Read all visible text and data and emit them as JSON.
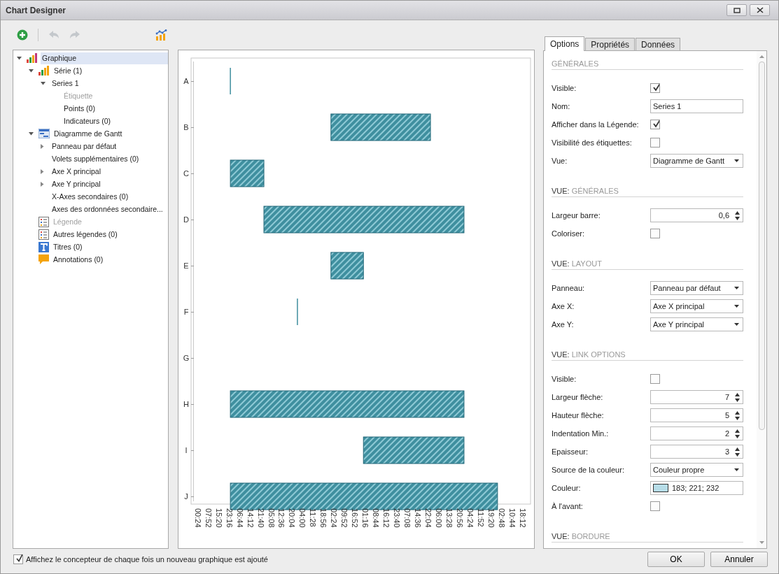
{
  "window": {
    "title": "Chart Designer"
  },
  "toolbar": {
    "undo_disabled": true,
    "redo_disabled": true
  },
  "tree": [
    {
      "label": "Graphique",
      "kind": "chart",
      "selected": true,
      "disabled": false,
      "expanded": true,
      "children": [
        {
          "label": "Série (1)",
          "kind": "series",
          "selected": false,
          "disabled": false,
          "expanded": true,
          "children": [
            {
              "label": "Series 1",
              "selected": false,
              "disabled": false,
              "expanded": true,
              "children": [
                {
                  "label": "Étiquette",
                  "selected": false,
                  "disabled": true
                },
                {
                  "label": "Points (0)",
                  "selected": false,
                  "disabled": false
                },
                {
                  "label": "Indicateurs (0)",
                  "selected": false,
                  "disabled": false
                }
              ]
            }
          ]
        },
        {
          "label": "Diagramme de Gantt",
          "kind": "diagram",
          "selected": false,
          "disabled": false,
          "expanded": true,
          "children": [
            {
              "label": "Panneau par défaut",
              "selected": false,
              "disabled": false,
              "expanded": false
            },
            {
              "label": "Volets supplémentaires (0)",
              "selected": false,
              "disabled": false
            },
            {
              "label": "Axe X principal",
              "selected": false,
              "disabled": false,
              "expanded": false
            },
            {
              "label": "Axe Y principal",
              "selected": false,
              "disabled": false,
              "expanded": false
            },
            {
              "label": "X-Axes secondaires (0)",
              "selected": false,
              "disabled": false
            },
            {
              "label": "Axes des ordonnées secondaire...",
              "selected": false,
              "disabled": false
            }
          ]
        },
        {
          "label": "Légende",
          "kind": "legend",
          "selected": false,
          "disabled": true
        },
        {
          "label": "Autres légendes (0)",
          "kind": "legend",
          "selected": false,
          "disabled": false
        },
        {
          "label": "Titres (0)",
          "kind": "titles",
          "selected": false,
          "disabled": false
        },
        {
          "label": "Annotations (0)",
          "kind": "annotations",
          "selected": false,
          "disabled": false
        }
      ]
    }
  ],
  "chart": {
    "categories": [
      "A",
      "B",
      "C",
      "D",
      "E",
      "F",
      "G",
      "H",
      "I",
      "J"
    ],
    "x_axis_labels": [
      "00:24",
      "07:52",
      "15:20",
      "23:16",
      "06:44",
      "14:12",
      "21:40",
      "05:08",
      "12:36",
      "20:04",
      "04:00",
      "11:28",
      "18:56",
      "02:24",
      "09:52",
      "16:52",
      "01:16",
      "08:44",
      "16:12",
      "23:40",
      "07:08",
      "14:36",
      "22:04",
      "06:00",
      "13:28",
      "20:56",
      "04:24",
      "11:52",
      "19:20",
      "02:48",
      "10:44",
      "18:12"
    ]
  },
  "tabs": [
    {
      "label": "Options",
      "selected": true
    },
    {
      "label": "Propriétés",
      "selected": false
    },
    {
      "label": "Données",
      "selected": false
    }
  ],
  "sections": [
    {
      "title": "GÉNÉRALES",
      "rows": [
        {
          "kind": "checkbox",
          "label": "Visible:",
          "checked": true
        },
        {
          "kind": "text",
          "label": "Nom:",
          "value": "Series 1"
        },
        {
          "kind": "checkbox",
          "label": "Afficher dans la Légende:",
          "checked": true
        },
        {
          "kind": "checkbox",
          "label": "Visibilité des étiquettes:",
          "checked": false
        },
        {
          "kind": "combo",
          "label": "Vue:",
          "value": "Diagramme de Gantt"
        }
      ]
    },
    {
      "prefix": "VUE:",
      "title": "GÉNÉRALES",
      "rows": [
        {
          "kind": "spin",
          "label": "Largeur barre:",
          "value": "0,6"
        },
        {
          "kind": "checkbox",
          "label": "Coloriser:",
          "checked": false
        }
      ]
    },
    {
      "prefix": "VUE:",
      "title": "LAYOUT",
      "rows": [
        {
          "kind": "combo",
          "label": "Panneau:",
          "value": "Panneau par défaut"
        },
        {
          "kind": "combo",
          "label": "Axe X:",
          "value": "Axe X principal"
        },
        {
          "kind": "combo",
          "label": "Axe Y:",
          "value": "Axe Y principal"
        }
      ]
    },
    {
      "prefix": "VUE:",
      "title": "LINK OPTIONS",
      "rows": [
        {
          "kind": "checkbox",
          "label": "Visible:",
          "checked": false
        },
        {
          "kind": "spin",
          "label": "Largeur flèche:",
          "value": "7"
        },
        {
          "kind": "spin",
          "label": "Hauteur flèche:",
          "value": "5"
        },
        {
          "kind": "spin",
          "label": "Indentation Min.:",
          "value": "2"
        },
        {
          "kind": "spin",
          "label": "Epaisseur:",
          "value": "3"
        },
        {
          "kind": "combo",
          "label": "Source de la couleur:",
          "value": "Couleur propre"
        },
        {
          "kind": "color",
          "label": "Couleur:",
          "value": "183; 221; 232",
          "color": "#b7dde8"
        },
        {
          "kind": "checkbox",
          "label": "À l'avant:",
          "checked": false
        }
      ]
    },
    {
      "prefix": "VUE:",
      "title": "BORDURE"
    }
  ],
  "footer": {
    "checkbox": {
      "label": "Affichez le concepteur de chaque fois un nouveau graphique est ajouté",
      "checked": true
    },
    "buttons": [
      "OK",
      "Annuler"
    ]
  }
}
